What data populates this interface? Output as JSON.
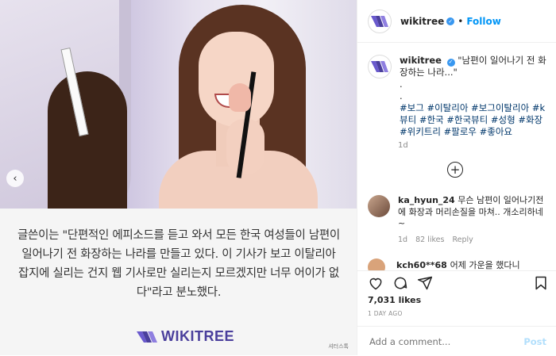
{
  "post_image": {
    "caption": "글쓴이는 \"단편적인 에피소드를 듣고 와서 모든 한국 여성들이 남편이 일어나기 전 화장하는 나라를 만들고 있다. 이 기사가 보고 이탈리아 잡지에 실리는 건지 웹 기사로만 실리는지 모르겠지만 너무 어이가 없다\"라고 분노했다.",
    "logo_text": "WIKITREE",
    "watermark": "셔터스톡",
    "prev_icon": "chevron-left-icon"
  },
  "header": {
    "username": "wikitree",
    "verified": "✓",
    "separator": "•",
    "follow_label": "Follow"
  },
  "post": {
    "username": "wikitree",
    "verified": "✓",
    "text_line1": "\"남편이 일어나기 전 화장하는 나라...\"",
    "dot1": ".",
    "dot2": ".",
    "hashtags": "#보그 #이탈리아 #보그이탈리아 #k뷰티 #한국 #한국뷰티 #성형 #화장 #위키트리 #팔로우 #좋아요",
    "time": "1d",
    "load_more": "+"
  },
  "comments": [
    {
      "username": "ka_hyun_24",
      "text": "무슨 남편이 일어나기전에 화장과 머리손질을 마쳐.. 개소리하네~",
      "time": "1d",
      "likes": "82 likes",
      "reply": "Reply"
    },
    {
      "username": "kch60**68",
      "text": "어제 가운을 했다니"
    }
  ],
  "likes": "7,031 likes",
  "date": "1 DAY AGO",
  "add_comment": {
    "placeholder": "Add a comment...",
    "post_label": "Post"
  },
  "colors": {
    "accent": "#0095f6",
    "brand": "#4a3f9c",
    "hashtag": "#00376b"
  }
}
